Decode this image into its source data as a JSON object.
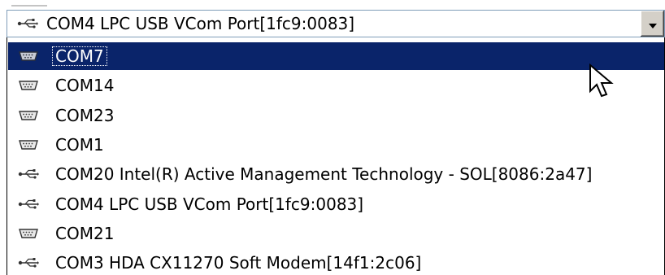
{
  "combo": {
    "selected_icon": "usb-icon",
    "selected_label": "COM4 LPC USB VCom Port[1fc9:0083]",
    "dropdown_icon": "chevron-down-icon"
  },
  "list": {
    "items": [
      {
        "icon": "serial-port-icon",
        "label": "COM7",
        "selected": true
      },
      {
        "icon": "serial-port-icon",
        "label": "COM14",
        "selected": false
      },
      {
        "icon": "serial-port-icon",
        "label": "COM23",
        "selected": false
      },
      {
        "icon": "serial-port-icon",
        "label": "COM1",
        "selected": false
      },
      {
        "icon": "usb-icon",
        "label": "COM20 Intel(R) Active Management Technology - SOL[8086:2a47]",
        "selected": false
      },
      {
        "icon": "usb-icon",
        "label": "COM4 LPC USB VCom Port[1fc9:0083]",
        "selected": false
      },
      {
        "icon": "serial-port-icon",
        "label": "COM21",
        "selected": false
      },
      {
        "icon": "usb-icon",
        "label": "COM3 HDA CX11270 Soft Modem[14f1:2c06]",
        "selected": false
      }
    ]
  },
  "colors": {
    "selection_bg": "#0a246a",
    "selection_fg": "#ffffff",
    "combo_border": "#7f9db9",
    "button_face": "#d4d0c8"
  }
}
